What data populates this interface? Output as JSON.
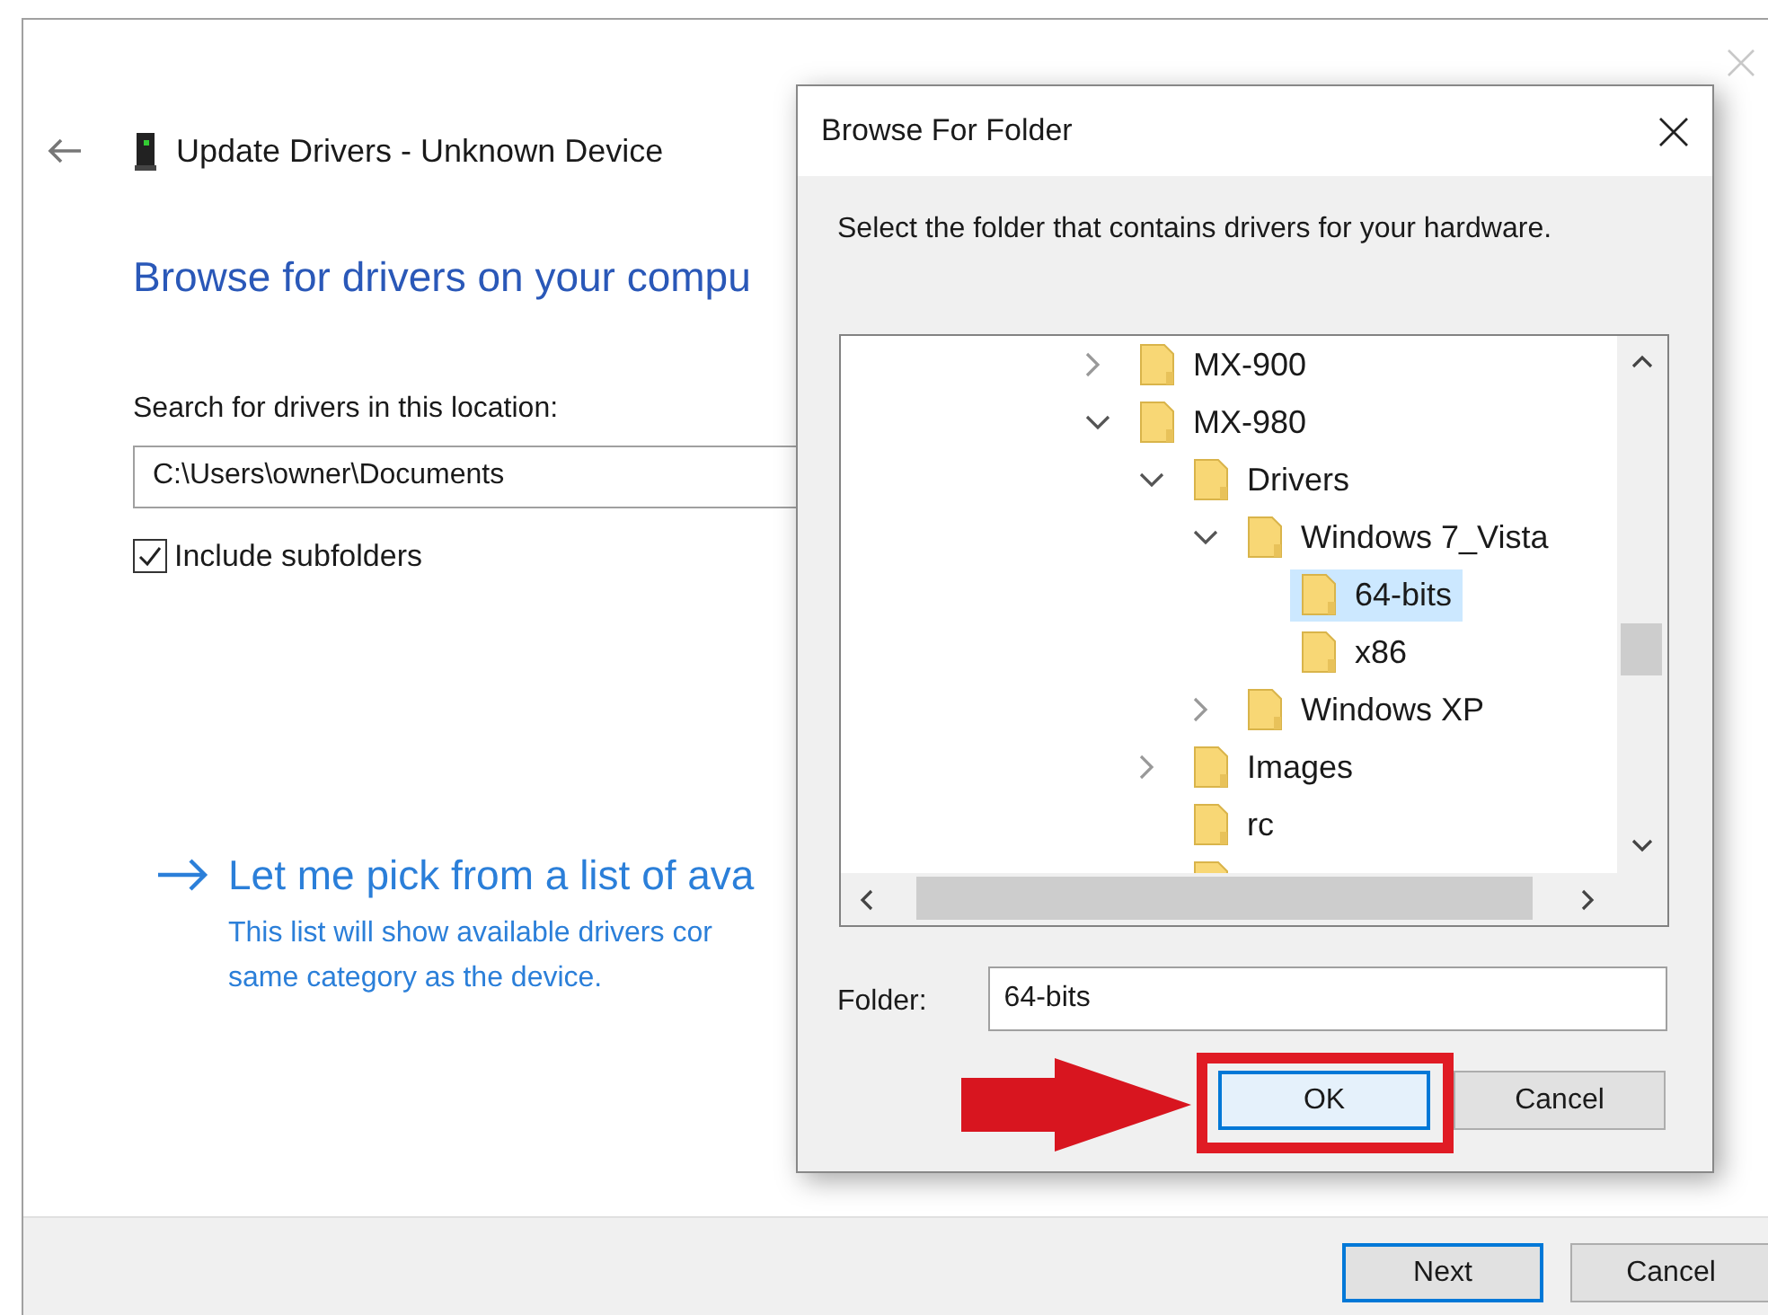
{
  "window": {
    "title": "Update Drivers - Unknown Device",
    "heading": "Browse for drivers on your compu",
    "location_label": "Search for drivers in this location:",
    "location_value": "C:\\Users\\owner\\Documents",
    "include_subfolders": {
      "label": "Include subfolders",
      "checked": true
    },
    "pick_link": {
      "title": "Let me pick from a list of ava",
      "description": [
        "This list will show available drivers cor",
        "same category as the device."
      ]
    },
    "buttons": [
      {
        "label": "Next",
        "default": true
      },
      {
        "label": "Cancel",
        "default": false
      }
    ]
  },
  "dialog": {
    "title": "Browse For Folder",
    "instruction": "Select the folder that contains drivers for your hardware.",
    "tree": [
      {
        "label": "MX-900",
        "expanded": false,
        "selected": false
      },
      {
        "label": "MX-980",
        "expanded": true,
        "selected": false,
        "children": [
          {
            "label": "Drivers",
            "expanded": true,
            "selected": false,
            "children": [
              {
                "label": "Windows 7_Vista",
                "expanded": true,
                "selected": false,
                "children": [
                  {
                    "label": "64-bits",
                    "selected": true
                  },
                  {
                    "label": "x86",
                    "selected": false
                  }
                ]
              },
              {
                "label": "Windows XP",
                "expanded": false,
                "selected": false
              }
            ]
          },
          {
            "label": "Images",
            "expanded": false,
            "selected": false
          },
          {
            "label": "rc",
            "selected": false
          }
        ]
      }
    ],
    "folder_label": "Folder:",
    "folder_value": "64-bits",
    "buttons": [
      {
        "label": "OK",
        "default": true,
        "highlighted": true
      },
      {
        "label": "Cancel",
        "default": false,
        "highlighted": false
      }
    ]
  }
}
